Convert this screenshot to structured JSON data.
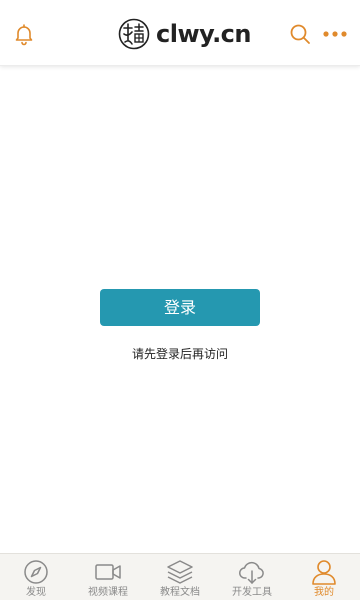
{
  "header": {
    "logo_text": "clwy.cn",
    "logo_mark": "site-logo-seal",
    "left_icon": "bell-icon",
    "search_icon": "search-icon",
    "more_icon": "more-icon"
  },
  "main": {
    "login_button_label": "登录",
    "hint_text": "请先登录后再访问"
  },
  "tabbar": {
    "items": [
      {
        "label": "发现",
        "icon": "compass-icon",
        "active": false
      },
      {
        "label": "视频课程",
        "icon": "video-icon",
        "active": false
      },
      {
        "label": "教程文档",
        "icon": "layers-icon",
        "active": false
      },
      {
        "label": "开发工具",
        "icon": "cloud-download-icon",
        "active": false
      },
      {
        "label": "我的",
        "icon": "user-icon",
        "active": true
      }
    ]
  },
  "colors": {
    "accent": "#e08a2c",
    "primary_button": "#2598b0",
    "tab_inactive": "#8a8a8a",
    "tabbar_bg": "#f5f4f1"
  }
}
